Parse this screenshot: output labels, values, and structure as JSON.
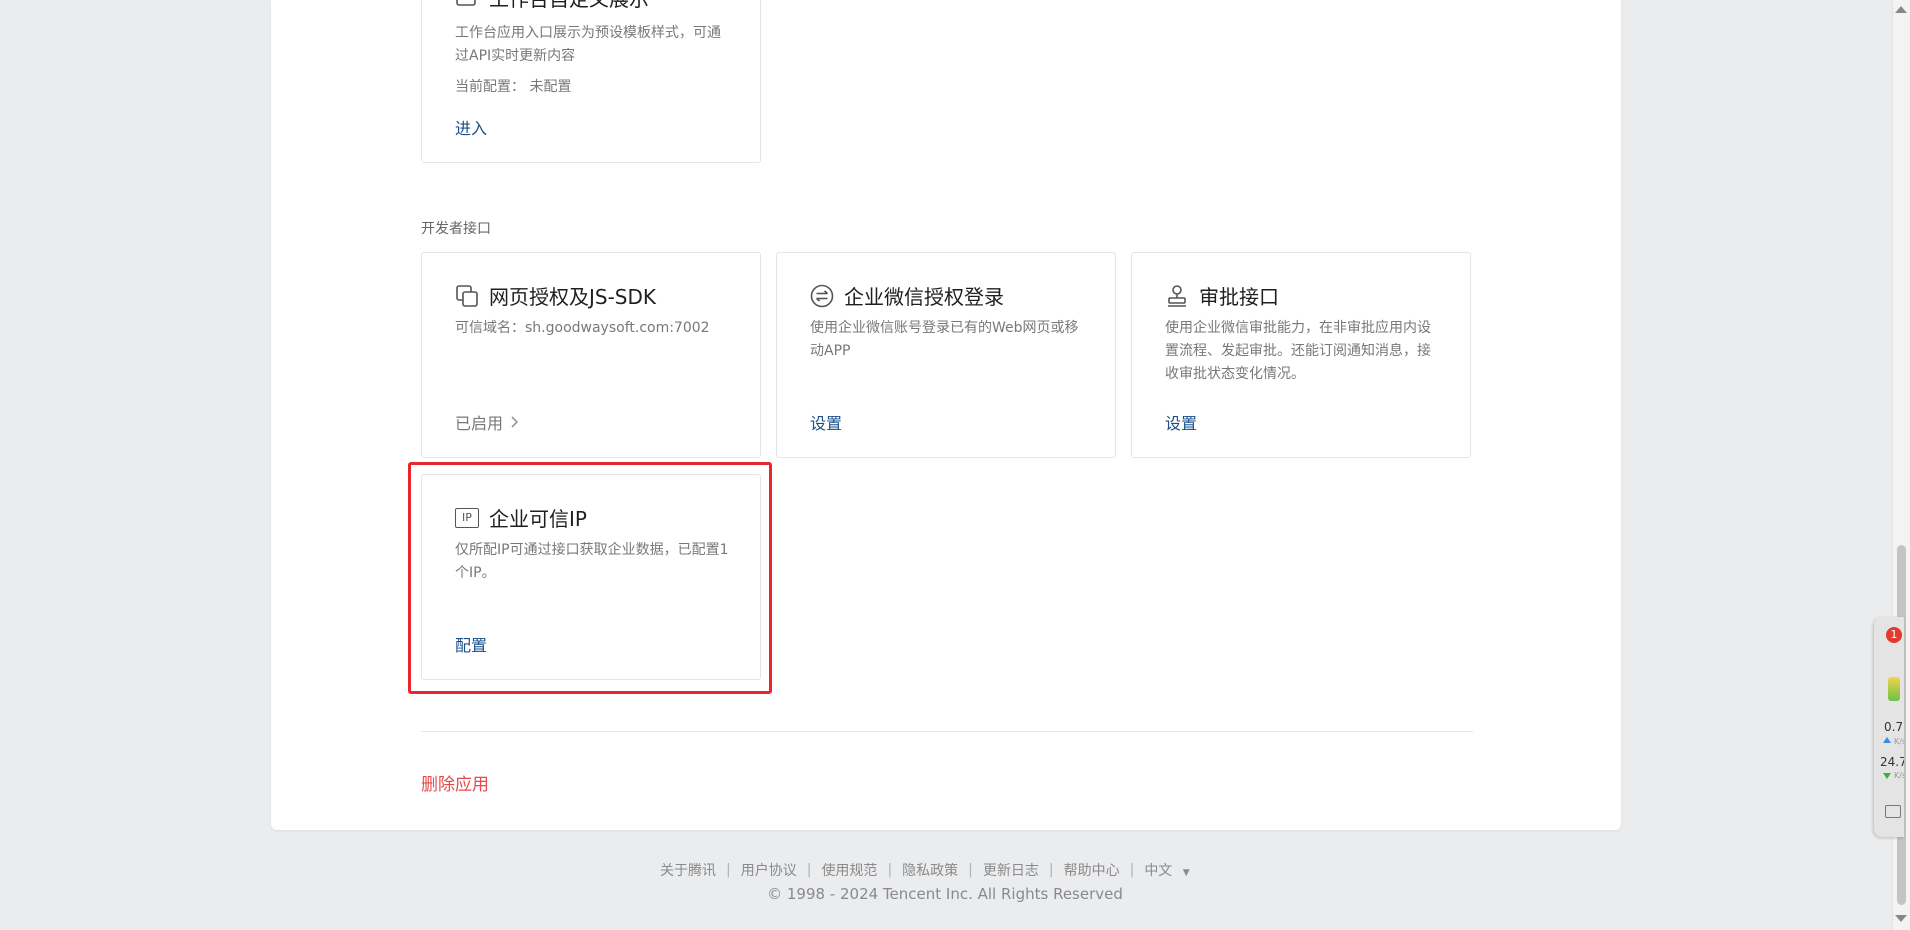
{
  "workbench_card": {
    "title_partial": "工作台自定义展示",
    "desc": "工作台应用入口展示为预设模板样式，可通过API实时更新内容",
    "config_label": "当前配置：",
    "config_value": "未配置",
    "link": "进入"
  },
  "section_title": "开发者接口",
  "cards": [
    {
      "title": "网页授权及JS-SDK",
      "icon": "copy-icon",
      "desc": "可信域名：sh.goodwaysoft.com:7002",
      "status": "已启用"
    },
    {
      "title": "企业微信授权登录",
      "icon": "exchange-icon",
      "desc": "使用企业微信账号登录已有的Web网页或移动APP",
      "link": "设置"
    },
    {
      "title": "审批接口",
      "icon": "stamp-icon",
      "desc": "使用企业微信审批能力，在非审批应用内设置流程、发起审批。还能订阅通知消息，接收审批状态变化情况。",
      "link": "设置"
    },
    {
      "title": "企业可信IP",
      "icon": "ip-icon",
      "icon_text": "IP",
      "desc": "仅所配IP可通过接口获取企业数据，已配置1个IP。",
      "link": "配置"
    }
  ],
  "delete_app": "删除应用",
  "footer": {
    "links": [
      "关于腾讯",
      "用户协议",
      "使用规范",
      "隐私政策",
      "更新日志",
      "帮助中心"
    ],
    "language": "中文",
    "copyright": "© 1998 - 2024 Tencent Inc. All Rights Reserved"
  },
  "widget": {
    "badge": "1",
    "upload": "0.7",
    "download": "24.7",
    "unit": "K/s"
  },
  "colors": {
    "link": "#1a4f8b",
    "danger": "#e34b4b",
    "highlight": "#e8262b"
  }
}
